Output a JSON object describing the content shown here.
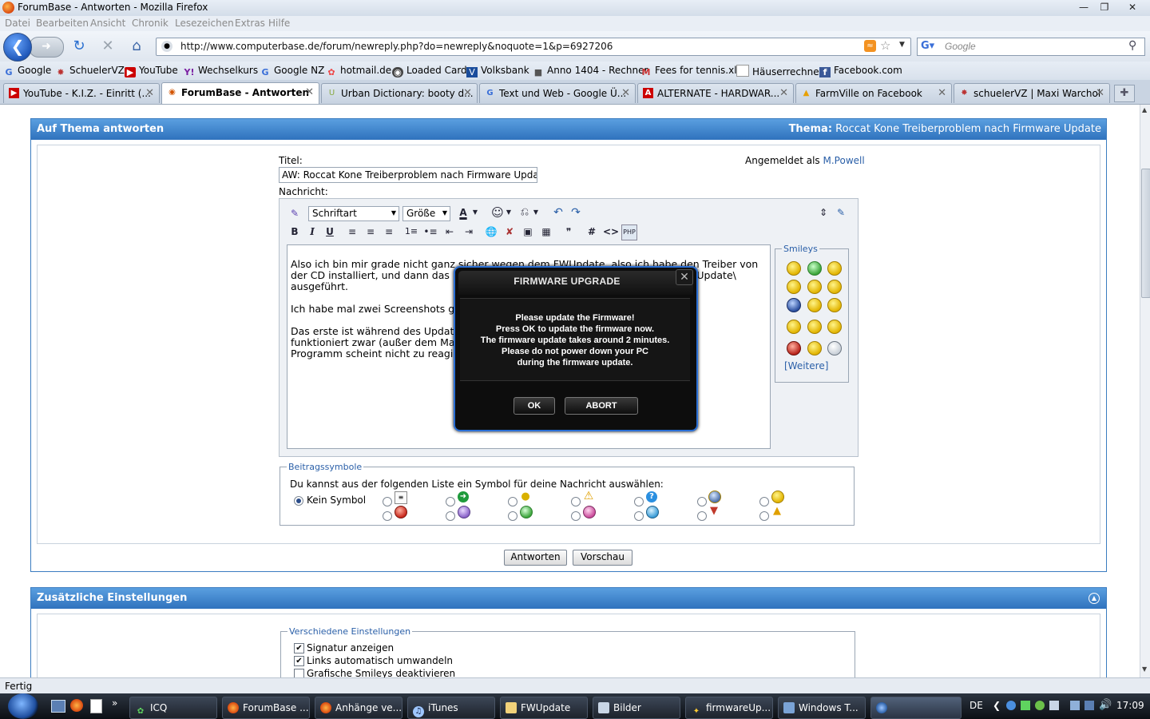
{
  "window": {
    "title": "ForumBase - Antworten - Mozilla Firefox"
  },
  "menu": [
    "Datei",
    "Bearbeiten",
    "Ansicht",
    "Chronik",
    "Lesezeichen",
    "Extras",
    "Hilfe"
  ],
  "nav": {
    "url": "http://www.computerbase.de/forum/newreply.php?do=newreply&noquote=1&p=6927206",
    "search_placeholder": "Google"
  },
  "bookmarks": [
    "Google",
    "SchuelerVZ",
    "YouTube",
    "Wechselkurs",
    "Google NZ",
    "hotmail.de",
    "Loaded Card",
    "Volksbank",
    "Anno 1404 - Rechner",
    "Fees for tennis.xls",
    "Häuserrechner",
    "Facebook.com"
  ],
  "tabs": [
    {
      "label": "YouTube - K.I.Z. - Einritt (..."
    },
    {
      "label": "ForumBase - Antworten"
    },
    {
      "label": "Urban Dictionary: booty d..."
    },
    {
      "label": "Text und Web - Google Ü..."
    },
    {
      "label": "ALTERNATE - HARDWAR..."
    },
    {
      "label": "FarmVille on Facebook"
    },
    {
      "label": "schuelerVZ | Maxi Warchol"
    }
  ],
  "reply": {
    "header": "Auf Thema antworten",
    "thread_label": "Thema:",
    "thread_title": "Roccat Kone Treiberproblem nach Firmware Update",
    "title_label": "Titel:",
    "title_value": "AW: Roccat Kone Treiberproblem nach Firmware Update",
    "logged_in_label": "Angemeldet als",
    "username": "M.Powell",
    "message_label": "Nachricht:",
    "font_select": "Schriftart",
    "size_select": "Größe",
    "message_lines": [
      "Also ich bin mir grade nicht ganz sicher wegen dem FWUpdate, also ich habe den Treiber von",
      "der CD installiert, und dann das Firmware Update aus C:\\Programme\\ROCCAT\\FWUpdate\\",
      "ausgeführt.",
      "",
      "Ich habe mal zwei Screenshots g",
      "",
      "Das erste ist während des Updat                                                   ate\" die Maus",
      "funktioniert zwar (außer dem Ma                                                   n, das",
      "Programm scheint nicht zu reagie"
    ],
    "smileys_legend": "Smileys",
    "smileys_more": "[Weitere]",
    "symbols_legend": "Beitragssymbole",
    "symbols_hint": "Du kannst aus der folgenden Liste ein Symbol für deine Nachricht auswählen:",
    "no_symbol": "Kein Symbol",
    "submit_button": "Antworten",
    "preview_button": "Vorschau"
  },
  "extra": {
    "header": "Zusätzliche Einstellungen",
    "misc_legend": "Verschiedene Einstellungen",
    "options": [
      {
        "label": "Signatur anzeigen",
        "checked": true
      },
      {
        "label": "Links automatisch umwandeln",
        "checked": true
      },
      {
        "label": "Grafische Smileys deaktivieren",
        "checked": false
      }
    ]
  },
  "dialog": {
    "title": "FIRMWARE UPGRADE",
    "lines": [
      "Please update the Firmware!",
      "Press OK to update the firmware now.",
      "The firmware update takes around 2 minutes.",
      "Please do not power down your PC",
      "during the firmware update."
    ],
    "ok_label": "OK",
    "abort_label": "ABORT"
  },
  "status": {
    "text": "Fertig"
  },
  "taskbar": {
    "items": [
      "ICQ",
      "ForumBase ...",
      "Anhänge ve...",
      "iTunes",
      "FWUpdate",
      "Bilder",
      "firmwareUp...",
      "Windows T..."
    ],
    "lang": "DE",
    "clock": "17:09"
  }
}
